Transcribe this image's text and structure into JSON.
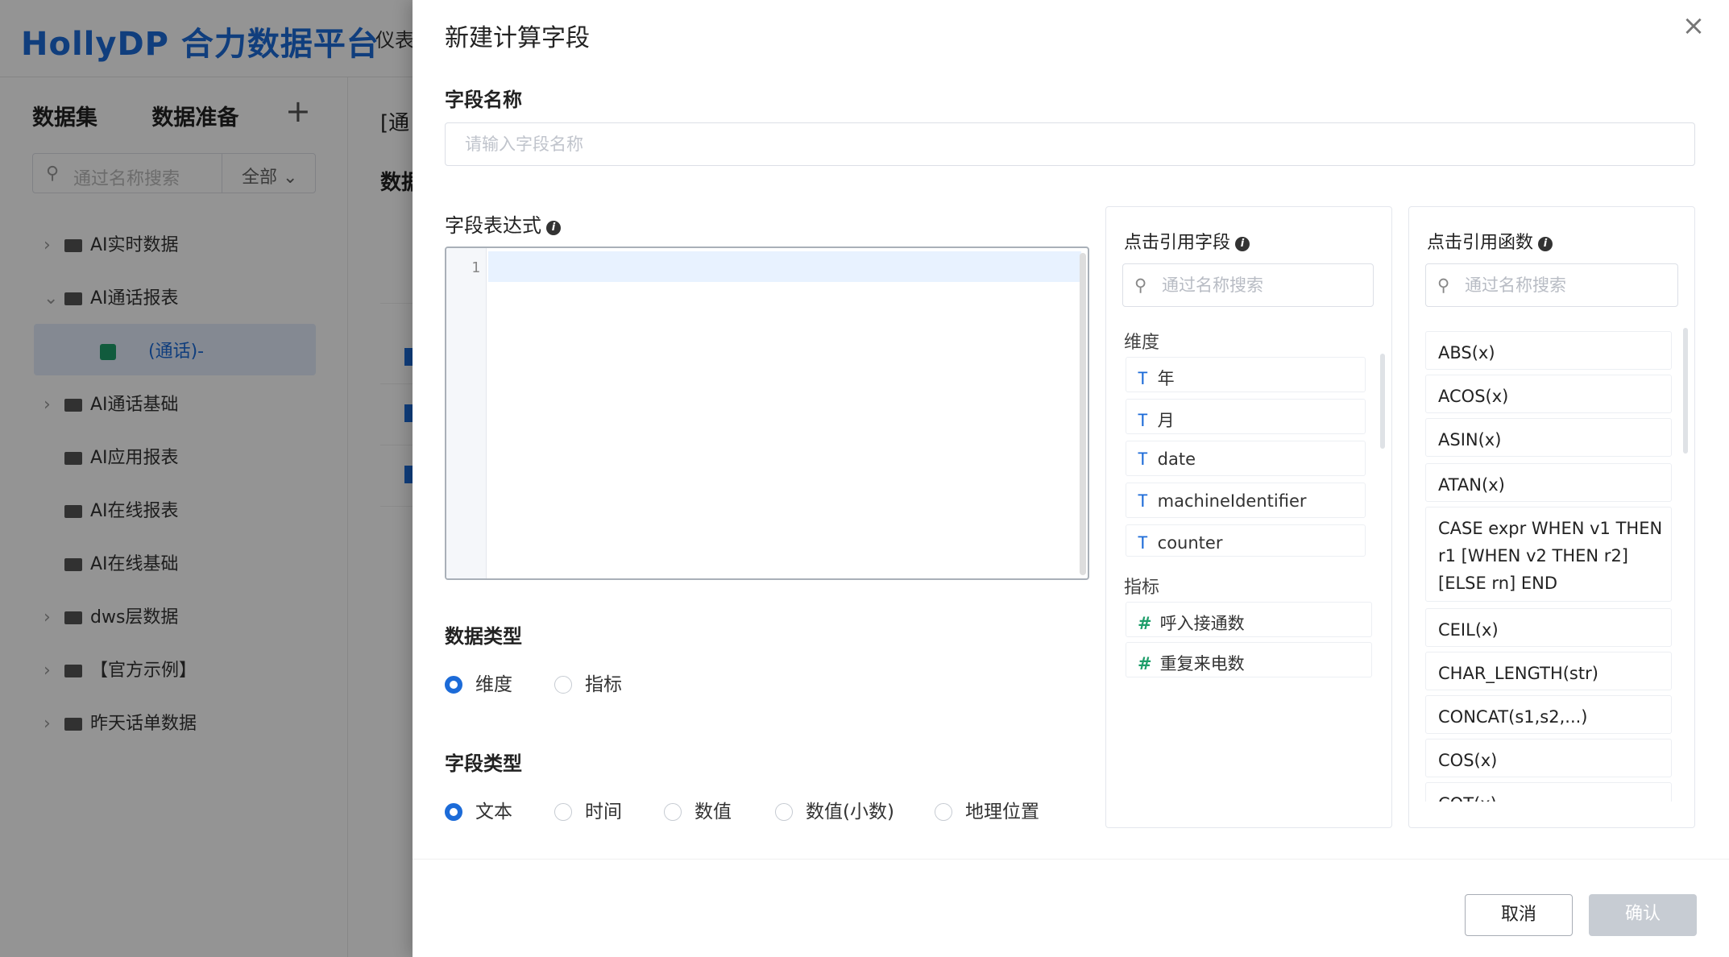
{
  "app": {
    "brand": "HollyDP 合力数据平台",
    "top_nav_partial": "仪表",
    "sidebar": {
      "tabs": [
        "数据集",
        "数据准备"
      ],
      "add_label": "+",
      "search_placeholder": "通过名称搜索",
      "scope_label": "全部",
      "tree": [
        "AI实时数据",
        "AI通话报表",
        "(通话)-",
        "AI通话基础",
        "AI应用报表",
        "AI在线报表",
        "AI在线基础",
        "dws层数据",
        "【官方示例】",
        "昨天话单数据"
      ]
    },
    "content": {
      "breadcrumb_partial": "[通",
      "section_partial": "数据"
    }
  },
  "dialog": {
    "title": "新建计算字段",
    "close_icon": "×",
    "field_name": {
      "label": "字段名称",
      "placeholder": "请输入字段名称",
      "value": ""
    },
    "expression": {
      "label": "字段表达式",
      "line_numbers": [
        "1"
      ],
      "value": ""
    },
    "data_type": {
      "label": "数据类型",
      "options": [
        "维度",
        "指标"
      ],
      "selected": "维度"
    },
    "field_type": {
      "label": "字段类型",
      "options": [
        "文本",
        "时间",
        "数值",
        "数值(小数)",
        "地理位置"
      ],
      "selected": "文本"
    },
    "field_ref": {
      "title": "点击引用字段",
      "search_placeholder": "通过名称搜索",
      "dimension_label": "维度",
      "dimensions": [
        "年",
        "月",
        "date",
        "machineIdentifier",
        "counter"
      ],
      "dimension_type_glyph": "T",
      "metric_label": "指标",
      "metrics": [
        "呼入接通数",
        "重复来电数"
      ],
      "metric_type_glyph": "#"
    },
    "func_ref": {
      "title": "点击引用函数",
      "search_placeholder": "通过名称搜索",
      "functions": [
        "ABS(x)",
        "ACOS(x)",
        "ASIN(x)",
        "ATAN(x)",
        "CASE expr WHEN v1 THEN r1 [WHEN v2 THEN r2] [ELSE rn] END",
        "CEIL(x)",
        "CHAR_LENGTH(str)",
        "CONCAT(s1,s2,...)",
        "COS(x)",
        "COT(x)"
      ]
    },
    "buttons": {
      "cancel": "取消",
      "confirm": "确认"
    },
    "colors": {
      "accent": "#1c6bd8",
      "metric_icon": "#1e9e6a",
      "confirm_disabled": "#c7ccd3"
    }
  }
}
